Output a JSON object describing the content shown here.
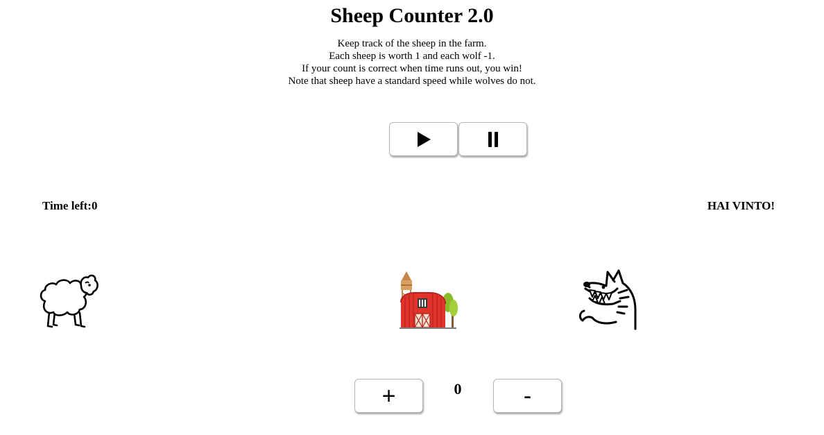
{
  "game": {
    "title": "Sheep Counter 2.0",
    "instructions": [
      "Keep track of the sheep in the farm.",
      "Each sheep is worth 1 and each wolf -1.",
      "If your count is correct when time runs out, you win!",
      "Note that sheep have a standard speed while wolves do not."
    ]
  },
  "controls": {
    "play_icon": "play-icon",
    "pause_icon": "pause-icon",
    "increment_label": "+",
    "decrement_label": "-"
  },
  "status": {
    "time_left_text": "Time left:0",
    "result_text": "HAI VINTO!",
    "count": "0"
  },
  "sprites": {
    "sheep": "sheep-icon",
    "barn": "barn-icon",
    "wolf": "wolf-icon"
  },
  "colors": {
    "barn_red": "#e0332b",
    "tree_green": "#8dbb2e",
    "tower_brown": "#c8864c"
  }
}
